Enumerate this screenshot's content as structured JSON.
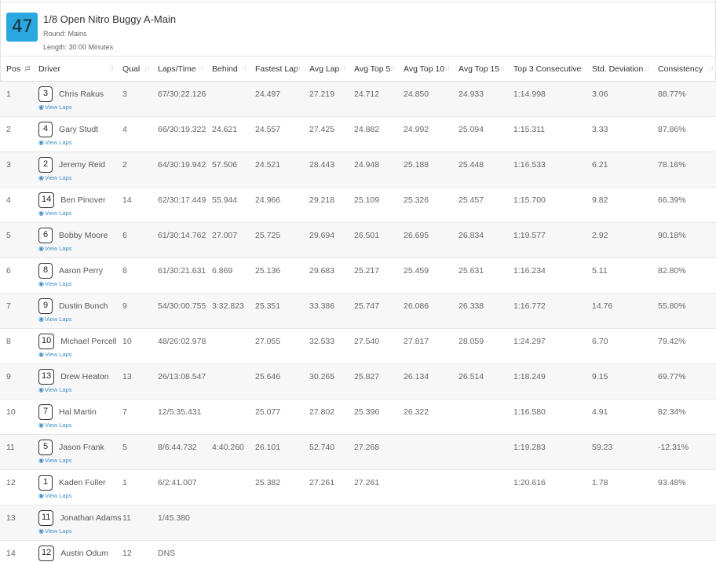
{
  "race": {
    "number": "47",
    "title": "1/8 Open Nitro Buggy A-Main",
    "round": "Round: Mains",
    "length": "Length: 30:00 Minutes"
  },
  "columns": [
    "Pos",
    "Driver",
    "Qual",
    "Laps/Time",
    "Behind",
    "Fastest Lap",
    "Avg Lap",
    "Avg Top 5",
    "Avg Top 10",
    "Avg Top 15",
    "Top 3 Consecutive",
    "Std. Deviation",
    "Consistency"
  ],
  "view_laps_label": "View Laps",
  "rows": [
    {
      "pos": "1",
      "car": "3",
      "driver": "Chris Rakus",
      "qual": "3",
      "laps_time": "67/30:22.126",
      "behind": "",
      "fastest": "24.497",
      "avg_lap": "27.219",
      "top5": "24.712",
      "top10": "24.850",
      "top15": "24.933",
      "top3c": "1:14.998",
      "std": "3.06",
      "consistency": "88.77%"
    },
    {
      "pos": "2",
      "car": "4",
      "driver": "Gary Studt",
      "qual": "4",
      "laps_time": "66/30:19.322",
      "behind": "24.621",
      "fastest": "24.557",
      "avg_lap": "27.425",
      "top5": "24.882",
      "top10": "24.992",
      "top15": "25.094",
      "top3c": "1:15.311",
      "std": "3.33",
      "consistency": "87.86%"
    },
    {
      "pos": "3",
      "car": "2",
      "driver": "Jeremy Reid",
      "qual": "2",
      "laps_time": "64/30:19.942",
      "behind": "57.506",
      "fastest": "24.521",
      "avg_lap": "28.443",
      "top5": "24.948",
      "top10": "25.188",
      "top15": "25.448",
      "top3c": "1:16.533",
      "std": "6.21",
      "consistency": "78.16%"
    },
    {
      "pos": "4",
      "car": "14",
      "driver": "Ben Pinover",
      "qual": "14",
      "laps_time": "62/30:17.449",
      "behind": "55.944",
      "fastest": "24.966",
      "avg_lap": "29.218",
      "top5": "25.109",
      "top10": "25.326",
      "top15": "25.457",
      "top3c": "1:15.700",
      "std": "9.82",
      "consistency": "66.39%"
    },
    {
      "pos": "5",
      "car": "6",
      "driver": "Bobby Moore",
      "qual": "6",
      "laps_time": "61/30:14.762",
      "behind": "27.007",
      "fastest": "25.725",
      "avg_lap": "29.694",
      "top5": "26.501",
      "top10": "26.695",
      "top15": "26.834",
      "top3c": "1:19.577",
      "std": "2.92",
      "consistency": "90.18%"
    },
    {
      "pos": "6",
      "car": "8",
      "driver": "Aaron Perry",
      "qual": "8",
      "laps_time": "61/30:21.631",
      "behind": "6.869",
      "fastest": "25.136",
      "avg_lap": "29.683",
      "top5": "25.217",
      "top10": "25.459",
      "top15": "25.631",
      "top3c": "1:16.234",
      "std": "5.11",
      "consistency": "82.80%"
    },
    {
      "pos": "7",
      "car": "9",
      "driver": "Dustin Bunch",
      "qual": "9",
      "laps_time": "54/30:00.755",
      "behind": "3:32.823",
      "fastest": "25.351",
      "avg_lap": "33.386",
      "top5": "25.747",
      "top10": "26.086",
      "top15": "26.338",
      "top3c": "1:16.772",
      "std": "14.76",
      "consistency": "55.80%"
    },
    {
      "pos": "8",
      "car": "10",
      "driver": "Michael Percell",
      "qual": "10",
      "laps_time": "48/26:02.978",
      "behind": "",
      "fastest": "27.055",
      "avg_lap": "32.533",
      "top5": "27.540",
      "top10": "27.817",
      "top15": "28.059",
      "top3c": "1:24.297",
      "std": "6.70",
      "consistency": "79.42%"
    },
    {
      "pos": "9",
      "car": "13",
      "driver": "Drew Heaton",
      "qual": "13",
      "laps_time": "26/13:08.547",
      "behind": "",
      "fastest": "25.646",
      "avg_lap": "30.265",
      "top5": "25.827",
      "top10": "26.134",
      "top15": "26.514",
      "top3c": "1:18.249",
      "std": "9.15",
      "consistency": "69.77%"
    },
    {
      "pos": "10",
      "car": "7",
      "driver": "Hal Martin",
      "qual": "7",
      "laps_time": "12/5:35.431",
      "behind": "",
      "fastest": "25.077",
      "avg_lap": "27.802",
      "top5": "25.396",
      "top10": "26.322",
      "top15": "",
      "top3c": "1:16.580",
      "std": "4.91",
      "consistency": "82.34%"
    },
    {
      "pos": "11",
      "car": "5",
      "driver": "Jason Frank",
      "qual": "5",
      "laps_time": "8/6:44.732",
      "behind": "4:40.260",
      "fastest": "26.101",
      "avg_lap": "52.740",
      "top5": "27.268",
      "top10": "",
      "top15": "",
      "top3c": "1:19.283",
      "std": "59.23",
      "consistency": "-12.31%"
    },
    {
      "pos": "12",
      "car": "1",
      "driver": "Kaden Fuller",
      "qual": "1",
      "laps_time": "6/2:41.007",
      "behind": "",
      "fastest": "25.382",
      "avg_lap": "27.261",
      "top5": "27.261",
      "top10": "",
      "top15": "",
      "top3c": "1:20.616",
      "std": "1.78",
      "consistency": "93.48%"
    },
    {
      "pos": "13",
      "car": "11",
      "driver": "Jonathan Adams",
      "qual": "11",
      "laps_time": "1/45.380",
      "behind": "",
      "fastest": "",
      "avg_lap": "",
      "top5": "",
      "top10": "",
      "top15": "",
      "top3c": "",
      "std": "",
      "consistency": ""
    },
    {
      "pos": "14",
      "car": "12",
      "driver": "Austin Odum",
      "qual": "12",
      "laps_time": "DNS",
      "behind": "",
      "fastest": "",
      "avg_lap": "",
      "top5": "",
      "top10": "",
      "top15": "",
      "top3c": "",
      "std": "",
      "consistency": ""
    }
  ]
}
